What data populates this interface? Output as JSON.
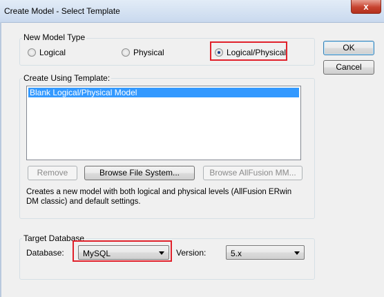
{
  "window": {
    "title": "Create Model - Select Template",
    "close_label": "x"
  },
  "model_type": {
    "group_label": "New Model Type",
    "options": [
      {
        "label": "Logical",
        "selected": false
      },
      {
        "label": "Physical",
        "selected": false
      },
      {
        "label": "Logical/Physical",
        "selected": true
      }
    ]
  },
  "buttons": {
    "ok": "OK",
    "cancel": "Cancel"
  },
  "template": {
    "group_label": "Create Using Template:",
    "items": [
      "Blank Logical/Physical Model"
    ],
    "remove_label": "Remove",
    "browse_fs_label": "Browse File System...",
    "browse_allfusion_label": "Browse AllFusion MM...",
    "description": "Creates a new model with both logical and physical levels (AllFusion ERwin DM classic) and default settings."
  },
  "target": {
    "group_label": "Target Database",
    "database_label": "Database:",
    "database_value": "MySQL",
    "version_label": "Version:",
    "version_value": "5.x"
  },
  "colors": {
    "highlight": "#e0202a",
    "selection": "#3399ff",
    "close": "#c7432f"
  }
}
